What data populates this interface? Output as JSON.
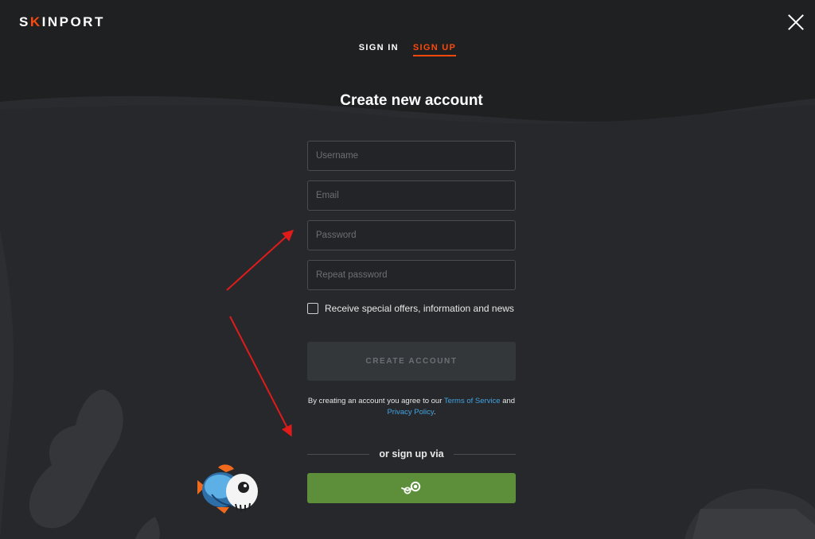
{
  "app": {
    "logo_text_start": "S",
    "logo_accent": "K",
    "logo_text_end": "INPORT"
  },
  "tabs": [
    {
      "label": "SIGN IN",
      "active": false
    },
    {
      "label": "SIGN UP",
      "active": true
    }
  ],
  "form": {
    "title": "Create new account",
    "username_placeholder": "Username",
    "email_placeholder": "Email",
    "password_placeholder": "Password",
    "repeat_password_placeholder": "Repeat password",
    "newsletter_label": "Receive special offers, information and news",
    "newsletter_checked": false,
    "create_button": "CREATE ACCOUNT",
    "terms_prefix": "By creating an account you agree to our ",
    "terms_link": "Terms of Service",
    "terms_and": " and ",
    "privacy_link": "Privacy Policy",
    "terms_suffix": ".",
    "divider_text": "or sign up via",
    "steam_button_icon": "steam-icon"
  },
  "colors": {
    "background": "#1f2022",
    "accent": "#fa490a",
    "link": "#41a3e0",
    "steam_green": "#5d8f3b",
    "annotation_arrow": "#e01b1b"
  }
}
